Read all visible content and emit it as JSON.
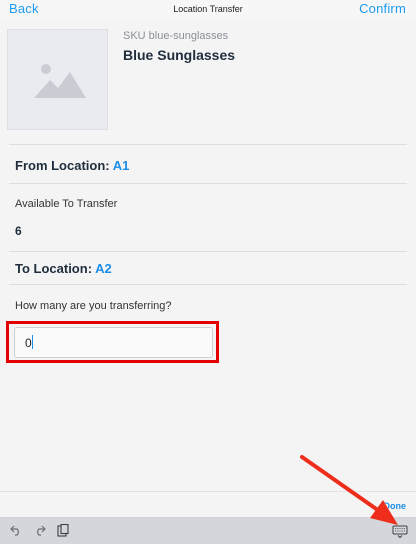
{
  "navbar": {
    "back_label": "Back",
    "title": "Location Transfer",
    "confirm_label": "Confirm"
  },
  "product": {
    "image_icon": "image-placeholder-icon",
    "sku": "SKU blue-sunglasses",
    "name": "Blue Sunglasses"
  },
  "from_location": {
    "label": "From Location:",
    "code": "A1"
  },
  "available": {
    "label": "Available To Transfer",
    "value": "6"
  },
  "to_location": {
    "label": "To Location:",
    "code": "A2"
  },
  "quantity": {
    "question": "How many are you transferring?",
    "value": "0"
  },
  "footer": {
    "done_label": "Done"
  },
  "keyboard_toolbar": {
    "icons": [
      "undo-icon",
      "redo-icon",
      "paste-icon",
      "keyboard-dismiss-icon"
    ]
  },
  "colors": {
    "accent": "#1d8ee6",
    "highlight": "#e30000",
    "arrow": "#ee2e1b"
  }
}
